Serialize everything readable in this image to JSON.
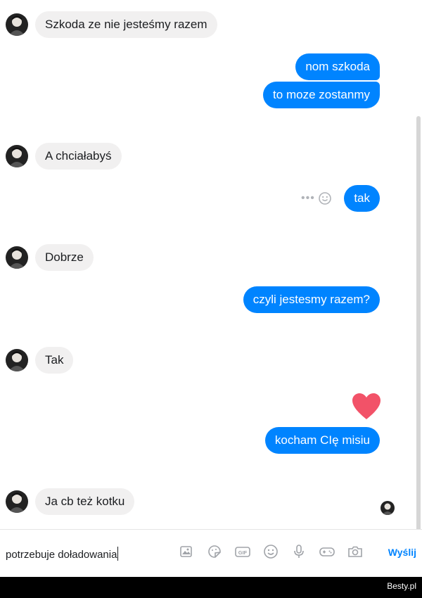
{
  "messages": [
    {
      "side": "in",
      "text": "Szkoda ze nie jesteśmy razem"
    },
    {
      "side": "out",
      "text": "nom szkoda"
    },
    {
      "side": "out",
      "text": "to moze zostanmy"
    },
    {
      "side": "in",
      "text": "A chciałabyś"
    },
    {
      "side": "out",
      "text": "tak"
    },
    {
      "side": "in",
      "text": "Dobrze"
    },
    {
      "side": "out",
      "text": "czyli jestesmy razem?"
    },
    {
      "side": "in",
      "text": "Tak"
    },
    {
      "side": "out",
      "text": "kocham CIę misiu"
    },
    {
      "side": "in",
      "text": "Ja cb też kotku"
    }
  ],
  "composer": {
    "input_value": "potrzebuje doładowania",
    "send_label": "Wyślij",
    "tools": [
      "image-icon",
      "sticker-icon",
      "gif-icon",
      "emoji-icon",
      "microphone-icon",
      "game-controller-icon",
      "camera-icon"
    ]
  },
  "reactions": {
    "dots": "•••"
  },
  "watermark": "Besty.pl",
  "colors": {
    "outgoing": "#0084ff",
    "incoming": "#f1f0f0",
    "heart": "#f25268",
    "send": "#0084ff"
  }
}
